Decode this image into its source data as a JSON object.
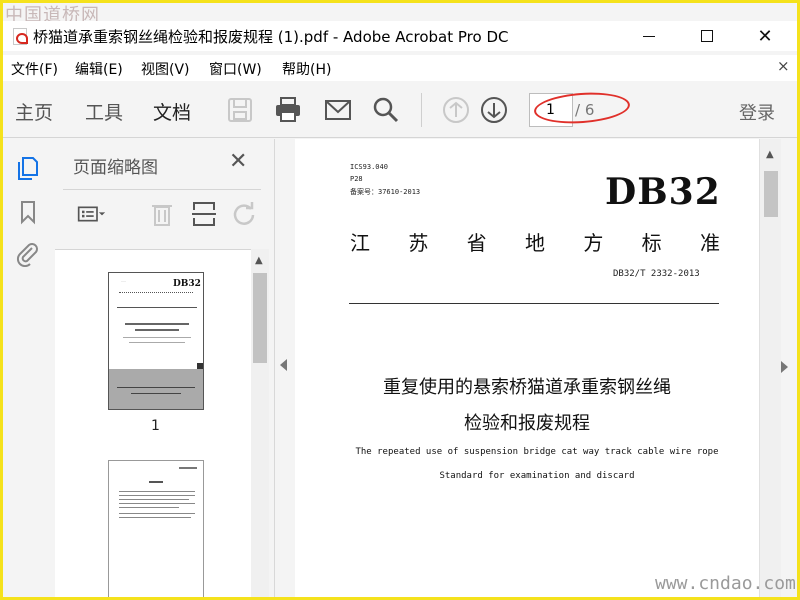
{
  "window": {
    "title": "桥猫道承重索钢丝绳检验和报废规程 (1).pdf - Adobe Acrobat Pro DC",
    "min_icon": "minimize-icon",
    "max_icon": "maximize-icon",
    "close_label": "✕"
  },
  "watermark": {
    "top": "中国道桥网",
    "bottom": "www.cndao.com"
  },
  "menu": {
    "items": [
      "文件(F)",
      "编辑(E)",
      "视图(V)",
      "窗口(W)",
      "帮助(H)"
    ],
    "close_label": "×"
  },
  "toolbar": {
    "tabs": [
      "主页",
      "工具",
      "文档"
    ],
    "active_tab": "文档",
    "icons": [
      "save-icon",
      "print-icon",
      "email-icon",
      "search-icon",
      "prev-page-icon",
      "next-page-icon"
    ],
    "current_page": "1",
    "total_pages": "/ 6",
    "login_label": "登录",
    "annotation_color": "#e0302a"
  },
  "rail": {
    "icons": [
      "page-thumbnails-icon",
      "bookmarks-icon",
      "attachments-icon"
    ],
    "accent": "#1473e6"
  },
  "thumb_panel": {
    "title": "页面缩略图",
    "close_label": "✕",
    "tools": [
      "thumbnail-options-icon",
      "delete-page-icon",
      "extract-page-icon",
      "rotate-page-icon"
    ],
    "thumbnails": [
      {
        "label": "1",
        "header": "DB32"
      }
    ]
  },
  "document": {
    "meta_ics": "ICS93.040",
    "meta_p": "P28",
    "meta_record": "备案号：37610-2013",
    "db_code": "DB32",
    "province_chars": [
      "江",
      "苏",
      "省",
      "地",
      "方",
      "标",
      "准"
    ],
    "standard_no": "DB32/T 2332-2013",
    "title_line1": "重复使用的悬索桥猫道承重索钢丝绳",
    "title_line2": "检验和报废规程",
    "english_line1": "The repeated use of suspension bridge cat way track cable wire rope",
    "english_line2": "Standard for examination and discard"
  }
}
